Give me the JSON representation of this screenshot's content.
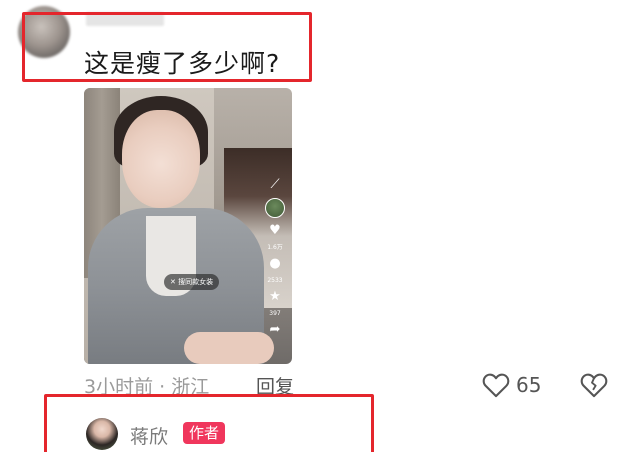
{
  "comment": {
    "text": "这是瘦了多少啊?"
  },
  "video": {
    "tag_text": "✕ 搜同款女装",
    "side": {
      "share_icon": "wand-icon",
      "like_count": "1.6万",
      "comment_count": "2533",
      "star_count": "397"
    }
  },
  "meta": {
    "time_location": "3小时前 · 浙江",
    "reply_label": "回复",
    "like_count": "65"
  },
  "author_reply": {
    "name": "蒋欣",
    "badge": "作者"
  },
  "colors": {
    "highlight_box": "#e4262c",
    "author_badge": "#f0365c"
  }
}
